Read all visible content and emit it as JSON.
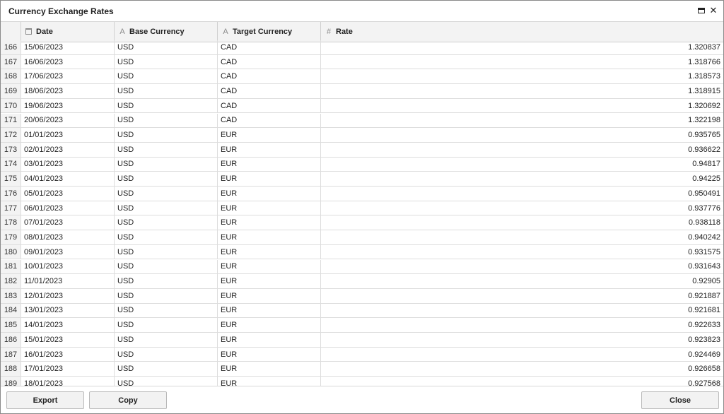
{
  "window": {
    "title": "Currency Exchange Rates"
  },
  "table": {
    "columns": [
      {
        "label": "Date",
        "icon": "calendar-icon"
      },
      {
        "label": "Base Currency",
        "icon": "text-type-icon",
        "glyph": "A"
      },
      {
        "label": "Target Currency",
        "icon": "text-type-icon",
        "glyph": "A"
      },
      {
        "label": "Rate",
        "icon": "number-type-icon",
        "glyph": "#"
      }
    ],
    "rows": [
      {
        "idx": "166",
        "date": "15/06/2023",
        "base": "USD",
        "target": "CAD",
        "rate": "1.320837"
      },
      {
        "idx": "167",
        "date": "16/06/2023",
        "base": "USD",
        "target": "CAD",
        "rate": "1.318766"
      },
      {
        "idx": "168",
        "date": "17/06/2023",
        "base": "USD",
        "target": "CAD",
        "rate": "1.318573"
      },
      {
        "idx": "169",
        "date": "18/06/2023",
        "base": "USD",
        "target": "CAD",
        "rate": "1.318915"
      },
      {
        "idx": "170",
        "date": "19/06/2023",
        "base": "USD",
        "target": "CAD",
        "rate": "1.320692"
      },
      {
        "idx": "171",
        "date": "20/06/2023",
        "base": "USD",
        "target": "CAD",
        "rate": "1.322198"
      },
      {
        "idx": "172",
        "date": "01/01/2023",
        "base": "USD",
        "target": "EUR",
        "rate": "0.935765"
      },
      {
        "idx": "173",
        "date": "02/01/2023",
        "base": "USD",
        "target": "EUR",
        "rate": "0.936622"
      },
      {
        "idx": "174",
        "date": "03/01/2023",
        "base": "USD",
        "target": "EUR",
        "rate": "0.94817"
      },
      {
        "idx": "175",
        "date": "04/01/2023",
        "base": "USD",
        "target": "EUR",
        "rate": "0.94225"
      },
      {
        "idx": "176",
        "date": "05/01/2023",
        "base": "USD",
        "target": "EUR",
        "rate": "0.950491"
      },
      {
        "idx": "177",
        "date": "06/01/2023",
        "base": "USD",
        "target": "EUR",
        "rate": "0.937776"
      },
      {
        "idx": "178",
        "date": "07/01/2023",
        "base": "USD",
        "target": "EUR",
        "rate": "0.938118"
      },
      {
        "idx": "179",
        "date": "08/01/2023",
        "base": "USD",
        "target": "EUR",
        "rate": "0.940242"
      },
      {
        "idx": "180",
        "date": "09/01/2023",
        "base": "USD",
        "target": "EUR",
        "rate": "0.931575"
      },
      {
        "idx": "181",
        "date": "10/01/2023",
        "base": "USD",
        "target": "EUR",
        "rate": "0.931643"
      },
      {
        "idx": "182",
        "date": "11/01/2023",
        "base": "USD",
        "target": "EUR",
        "rate": "0.92905"
      },
      {
        "idx": "183",
        "date": "12/01/2023",
        "base": "USD",
        "target": "EUR",
        "rate": "0.921887"
      },
      {
        "idx": "184",
        "date": "13/01/2023",
        "base": "USD",
        "target": "EUR",
        "rate": "0.921681"
      },
      {
        "idx": "185",
        "date": "14/01/2023",
        "base": "USD",
        "target": "EUR",
        "rate": "0.922633"
      },
      {
        "idx": "186",
        "date": "15/01/2023",
        "base": "USD",
        "target": "EUR",
        "rate": "0.923823"
      },
      {
        "idx": "187",
        "date": "16/01/2023",
        "base": "USD",
        "target": "EUR",
        "rate": "0.924469"
      },
      {
        "idx": "188",
        "date": "17/01/2023",
        "base": "USD",
        "target": "EUR",
        "rate": "0.926658"
      },
      {
        "idx": "189",
        "date": "18/01/2023",
        "base": "USD",
        "target": "EUR",
        "rate": "0.927568"
      }
    ]
  },
  "footer": {
    "export_label": "Export",
    "copy_label": "Copy",
    "close_label": "Close"
  }
}
